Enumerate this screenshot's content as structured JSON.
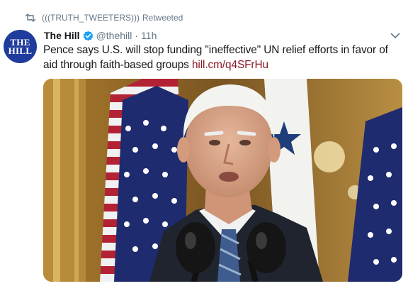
{
  "retweet": {
    "icon": "retweet-icon",
    "name": "(((TRUTH_TWEETERS)))",
    "label": "Retweeted"
  },
  "author": {
    "avatar_line1": "THE",
    "avatar_line2": "HILL",
    "display_name": "The Hill",
    "verified_icon": "verified-badge-icon",
    "handle": "@thehill",
    "separator": "·",
    "time": "11h"
  },
  "tweet": {
    "text": "Pence says U.S. will stop funding \"ineffective\" UN relief efforts in favor of aid through faith-based groups ",
    "link": "hill.cm/q4SFrHu"
  },
  "media": {
    "description_icon": "photo-icon"
  },
  "colors": {
    "link": "#8a1a24",
    "avatar_bg": "#1f3c9c",
    "verified": "#1da1f2",
    "muted": "#657786"
  }
}
